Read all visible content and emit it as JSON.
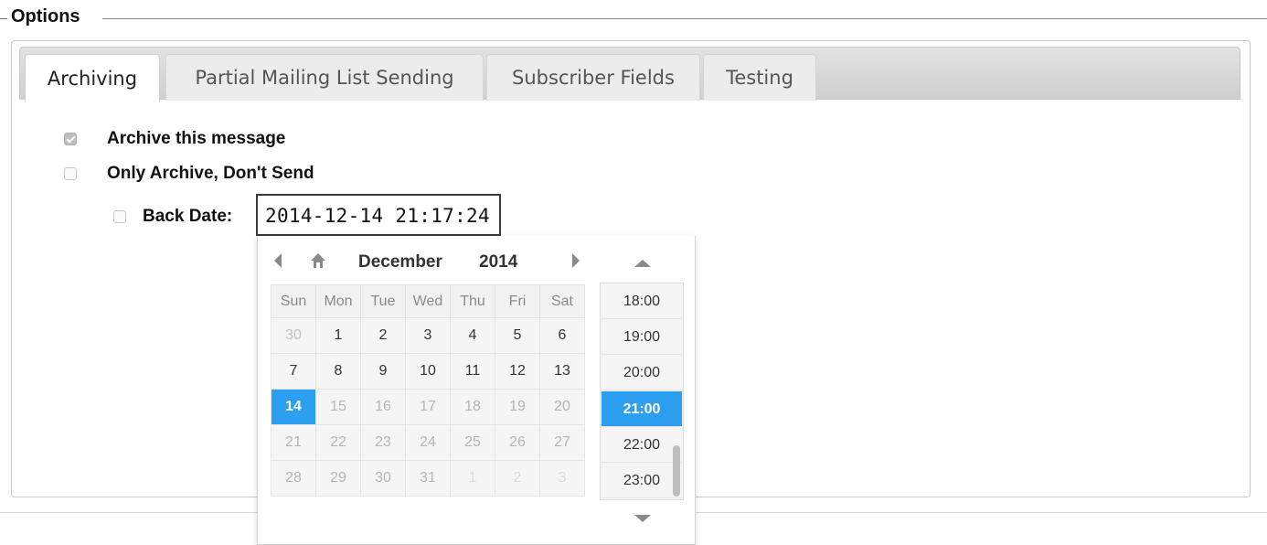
{
  "fieldset": {
    "legend": "Options"
  },
  "tabs": [
    {
      "label": "Archiving",
      "active": true
    },
    {
      "label": "Partial Mailing List Sending",
      "active": false
    },
    {
      "label": "Subscriber Fields",
      "active": false
    },
    {
      "label": "Testing",
      "active": false
    }
  ],
  "options": {
    "archive": {
      "label": "Archive this message",
      "checked": true
    },
    "only_archive": {
      "label": "Only Archive, Don't Send",
      "checked": false
    },
    "back_date": {
      "label": "Back Date:",
      "checked": false,
      "value": "2014-12-14 21:17:24"
    }
  },
  "picker": {
    "month": "December",
    "year": "2014",
    "weekdays": [
      "Sun",
      "Mon",
      "Tue",
      "Wed",
      "Thu",
      "Fri",
      "Sat"
    ],
    "weeks": [
      [
        "30",
        "1",
        "2",
        "3",
        "4",
        "5",
        "6"
      ],
      [
        "7",
        "8",
        "9",
        "10",
        "11",
        "12",
        "13"
      ],
      [
        "14",
        "15",
        "16",
        "17",
        "18",
        "19",
        "20"
      ],
      [
        "21",
        "22",
        "23",
        "24",
        "25",
        "26",
        "27"
      ],
      [
        "28",
        "29",
        "30",
        "31",
        "1",
        "2",
        "3"
      ]
    ],
    "selected_day": "14",
    "times": [
      "18:00",
      "19:00",
      "20:00",
      "21:00",
      "22:00",
      "23:00"
    ],
    "selected_time": "21:00",
    "icons": {
      "prev": "triangle-left-icon",
      "home": "home-icon",
      "next": "triangle-right-icon",
      "up": "triangle-up-icon",
      "down": "triangle-down-icon"
    },
    "colors": {
      "selected": "#2d9ff0"
    }
  }
}
